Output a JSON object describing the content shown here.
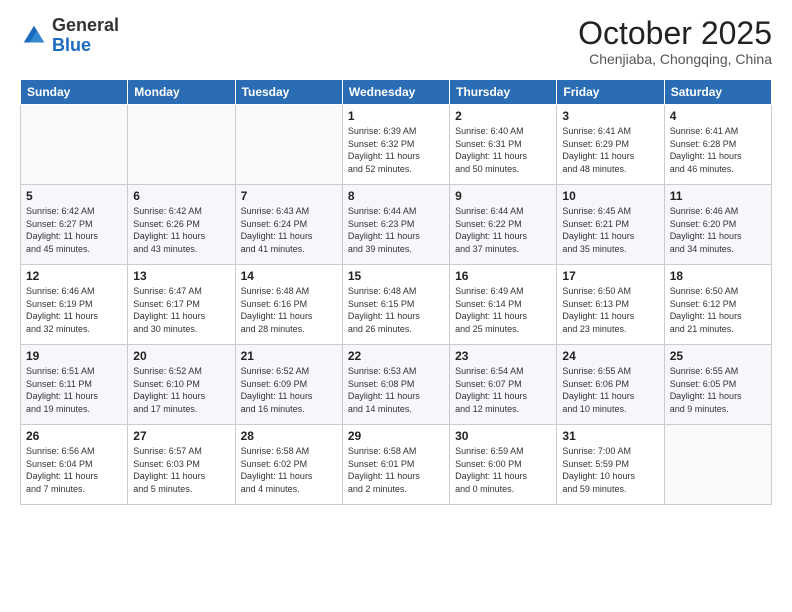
{
  "logo": {
    "general": "General",
    "blue": "Blue"
  },
  "header": {
    "month": "October 2025",
    "location": "Chenjiaba, Chongqing, China"
  },
  "days_of_week": [
    "Sunday",
    "Monday",
    "Tuesday",
    "Wednesday",
    "Thursday",
    "Friday",
    "Saturday"
  ],
  "weeks": [
    [
      {
        "day": "",
        "info": ""
      },
      {
        "day": "",
        "info": ""
      },
      {
        "day": "",
        "info": ""
      },
      {
        "day": "1",
        "info": "Sunrise: 6:39 AM\nSunset: 6:32 PM\nDaylight: 11 hours\nand 52 minutes."
      },
      {
        "day": "2",
        "info": "Sunrise: 6:40 AM\nSunset: 6:31 PM\nDaylight: 11 hours\nand 50 minutes."
      },
      {
        "day": "3",
        "info": "Sunrise: 6:41 AM\nSunset: 6:29 PM\nDaylight: 11 hours\nand 48 minutes."
      },
      {
        "day": "4",
        "info": "Sunrise: 6:41 AM\nSunset: 6:28 PM\nDaylight: 11 hours\nand 46 minutes."
      }
    ],
    [
      {
        "day": "5",
        "info": "Sunrise: 6:42 AM\nSunset: 6:27 PM\nDaylight: 11 hours\nand 45 minutes."
      },
      {
        "day": "6",
        "info": "Sunrise: 6:42 AM\nSunset: 6:26 PM\nDaylight: 11 hours\nand 43 minutes."
      },
      {
        "day": "7",
        "info": "Sunrise: 6:43 AM\nSunset: 6:24 PM\nDaylight: 11 hours\nand 41 minutes."
      },
      {
        "day": "8",
        "info": "Sunrise: 6:44 AM\nSunset: 6:23 PM\nDaylight: 11 hours\nand 39 minutes."
      },
      {
        "day": "9",
        "info": "Sunrise: 6:44 AM\nSunset: 6:22 PM\nDaylight: 11 hours\nand 37 minutes."
      },
      {
        "day": "10",
        "info": "Sunrise: 6:45 AM\nSunset: 6:21 PM\nDaylight: 11 hours\nand 35 minutes."
      },
      {
        "day": "11",
        "info": "Sunrise: 6:46 AM\nSunset: 6:20 PM\nDaylight: 11 hours\nand 34 minutes."
      }
    ],
    [
      {
        "day": "12",
        "info": "Sunrise: 6:46 AM\nSunset: 6:19 PM\nDaylight: 11 hours\nand 32 minutes."
      },
      {
        "day": "13",
        "info": "Sunrise: 6:47 AM\nSunset: 6:17 PM\nDaylight: 11 hours\nand 30 minutes."
      },
      {
        "day": "14",
        "info": "Sunrise: 6:48 AM\nSunset: 6:16 PM\nDaylight: 11 hours\nand 28 minutes."
      },
      {
        "day": "15",
        "info": "Sunrise: 6:48 AM\nSunset: 6:15 PM\nDaylight: 11 hours\nand 26 minutes."
      },
      {
        "day": "16",
        "info": "Sunrise: 6:49 AM\nSunset: 6:14 PM\nDaylight: 11 hours\nand 25 minutes."
      },
      {
        "day": "17",
        "info": "Sunrise: 6:50 AM\nSunset: 6:13 PM\nDaylight: 11 hours\nand 23 minutes."
      },
      {
        "day": "18",
        "info": "Sunrise: 6:50 AM\nSunset: 6:12 PM\nDaylight: 11 hours\nand 21 minutes."
      }
    ],
    [
      {
        "day": "19",
        "info": "Sunrise: 6:51 AM\nSunset: 6:11 PM\nDaylight: 11 hours\nand 19 minutes."
      },
      {
        "day": "20",
        "info": "Sunrise: 6:52 AM\nSunset: 6:10 PM\nDaylight: 11 hours\nand 17 minutes."
      },
      {
        "day": "21",
        "info": "Sunrise: 6:52 AM\nSunset: 6:09 PM\nDaylight: 11 hours\nand 16 minutes."
      },
      {
        "day": "22",
        "info": "Sunrise: 6:53 AM\nSunset: 6:08 PM\nDaylight: 11 hours\nand 14 minutes."
      },
      {
        "day": "23",
        "info": "Sunrise: 6:54 AM\nSunset: 6:07 PM\nDaylight: 11 hours\nand 12 minutes."
      },
      {
        "day": "24",
        "info": "Sunrise: 6:55 AM\nSunset: 6:06 PM\nDaylight: 11 hours\nand 10 minutes."
      },
      {
        "day": "25",
        "info": "Sunrise: 6:55 AM\nSunset: 6:05 PM\nDaylight: 11 hours\nand 9 minutes."
      }
    ],
    [
      {
        "day": "26",
        "info": "Sunrise: 6:56 AM\nSunset: 6:04 PM\nDaylight: 11 hours\nand 7 minutes."
      },
      {
        "day": "27",
        "info": "Sunrise: 6:57 AM\nSunset: 6:03 PM\nDaylight: 11 hours\nand 5 minutes."
      },
      {
        "day": "28",
        "info": "Sunrise: 6:58 AM\nSunset: 6:02 PM\nDaylight: 11 hours\nand 4 minutes."
      },
      {
        "day": "29",
        "info": "Sunrise: 6:58 AM\nSunset: 6:01 PM\nDaylight: 11 hours\nand 2 minutes."
      },
      {
        "day": "30",
        "info": "Sunrise: 6:59 AM\nSunset: 6:00 PM\nDaylight: 11 hours\nand 0 minutes."
      },
      {
        "day": "31",
        "info": "Sunrise: 7:00 AM\nSunset: 5:59 PM\nDaylight: 10 hours\nand 59 minutes."
      },
      {
        "day": "",
        "info": ""
      }
    ]
  ]
}
